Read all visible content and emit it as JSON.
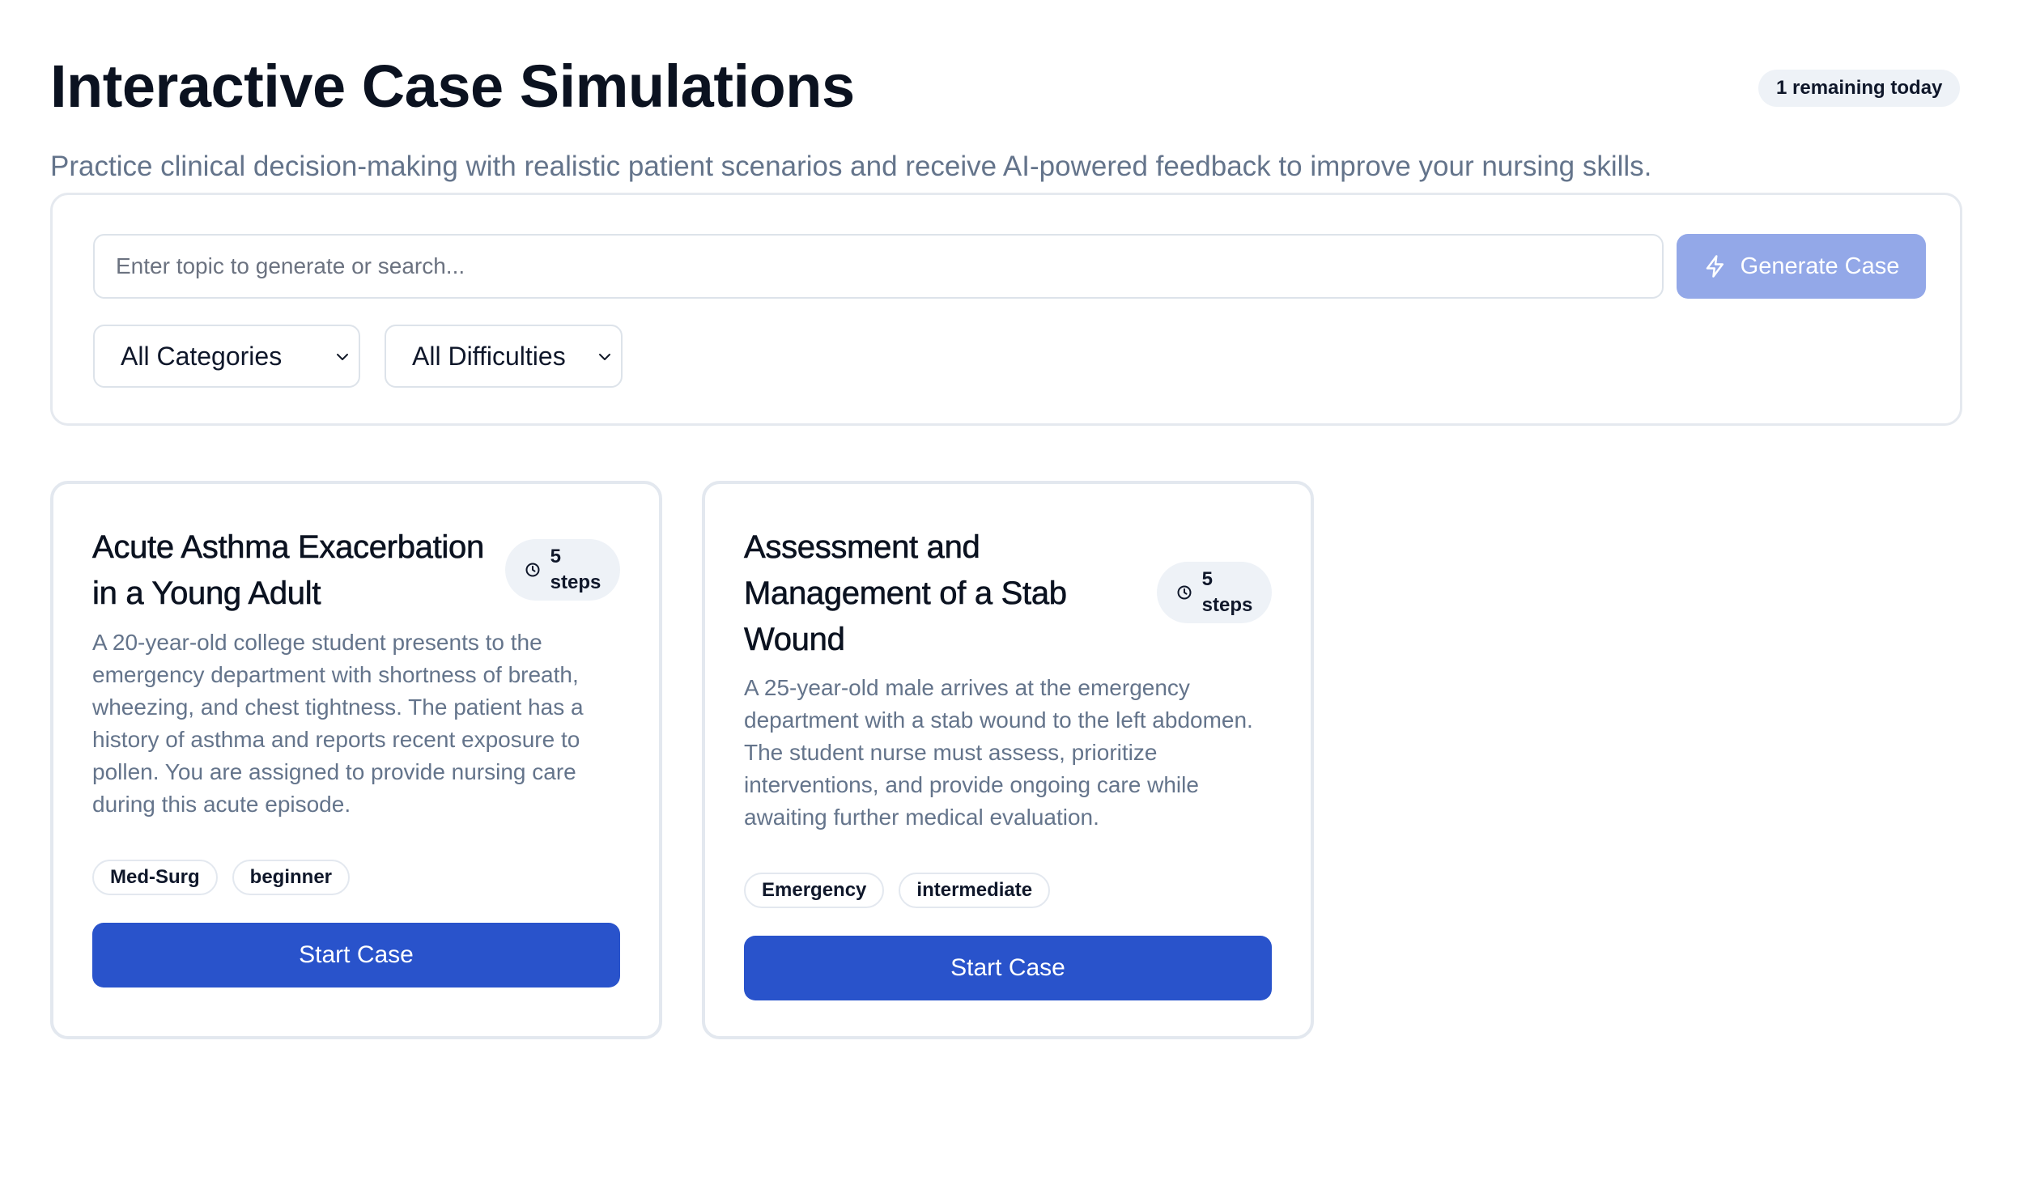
{
  "header": {
    "title": "Interactive Case Simulations",
    "remaining_badge": "1 remaining today",
    "subtitle": "Practice clinical decision-making with realistic patient scenarios and receive AI-powered feedback to improve your nursing skills."
  },
  "search": {
    "placeholder": "Enter topic to generate or search...",
    "value": "",
    "generate_label": "Generate Case",
    "generate_icon": "lightning-bolt-icon",
    "category_selected": "All Categories",
    "difficulty_selected": "All Difficulties"
  },
  "cases": [
    {
      "title": "Acute Asthma Exacerbation in a Young Adult",
      "steps_number": "5",
      "steps_unit": "steps",
      "description": "A 20-year-old college student presents to the emergency department with shortness of breath, wheezing, and chest tightness. The patient has a history of asthma and reports recent exposure to pollen. You are assigned to provide nursing care during this acute episode.",
      "category": "Med-Surg",
      "difficulty": "beginner",
      "button_label": "Start Case"
    },
    {
      "title": "Assessment and Management of a Stab Wound",
      "steps_number": "5",
      "steps_unit": "steps",
      "description": "A 25-year-old male arrives at the emergency department with a stab wound to the left abdomen. The student nurse must assess, prioritize interventions, and provide ongoing care while awaiting further medical evaluation.",
      "category": "Emergency",
      "difficulty": "intermediate",
      "button_label": "Start Case"
    }
  ],
  "colors": {
    "primary": "#2953cb",
    "primary_disabled": "#93a8e8",
    "muted_text": "#64748b",
    "badge_bg": "#eef2f7",
    "border": "#e3e8ef"
  }
}
